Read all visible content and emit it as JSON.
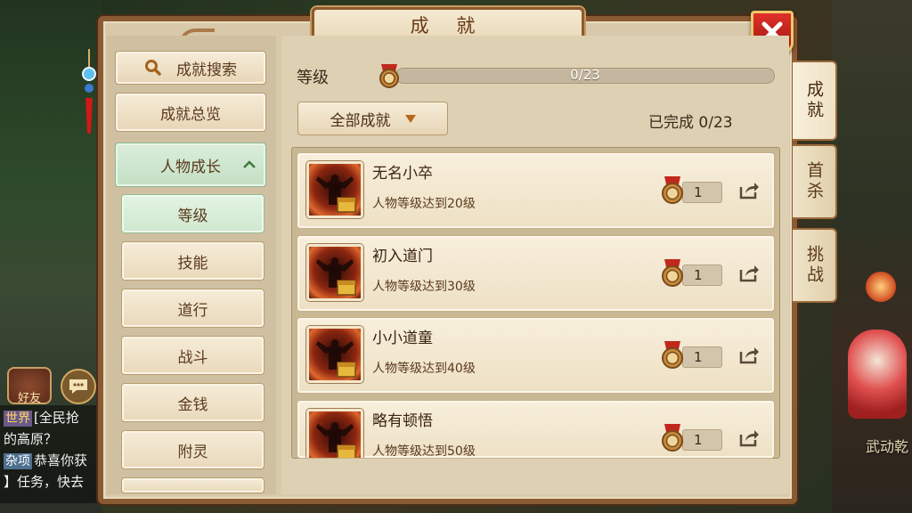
{
  "window": {
    "title": "成 就"
  },
  "nav": {
    "search": "成就搜索",
    "overview": "成就总览",
    "group": "人物成长",
    "sub_items": [
      "等级",
      "技能",
      "道行",
      "战斗",
      "金钱",
      "附灵"
    ],
    "active_sub": "等级"
  },
  "header": {
    "level_label": "等级",
    "progress_text": "0/23",
    "progress_fraction": 0,
    "filter_label": "全部成就",
    "completed_text": "已完成 0/23"
  },
  "achievements": [
    {
      "name": "无名小卒",
      "desc": "人物等级达到20级",
      "points": "1"
    },
    {
      "name": "初入道门",
      "desc": "人物等级达到30级",
      "points": "1"
    },
    {
      "name": "小小道童",
      "desc": "人物等级达到40级",
      "points": "1"
    },
    {
      "name": "略有顿悟",
      "desc": "人物等级达到50级",
      "points": "1"
    }
  ],
  "side_tabs": [
    "成就",
    "首杀",
    "挑战"
  ],
  "background": {
    "chat_lines": [
      {
        "tag": "世界",
        "text": "[全民抢"
      },
      {
        "tag": "",
        "text": "的高原？"
      },
      {
        "tag": "杂项",
        "text": "恭喜你获"
      },
      {
        "tag": "",
        "text": "】任务，快去"
      }
    ],
    "friends_label": "好友",
    "caption": "武动乾"
  },
  "colors": {
    "accent": "#8a5a34",
    "close": "#c8241c",
    "active_green": "#cfe8cf"
  }
}
